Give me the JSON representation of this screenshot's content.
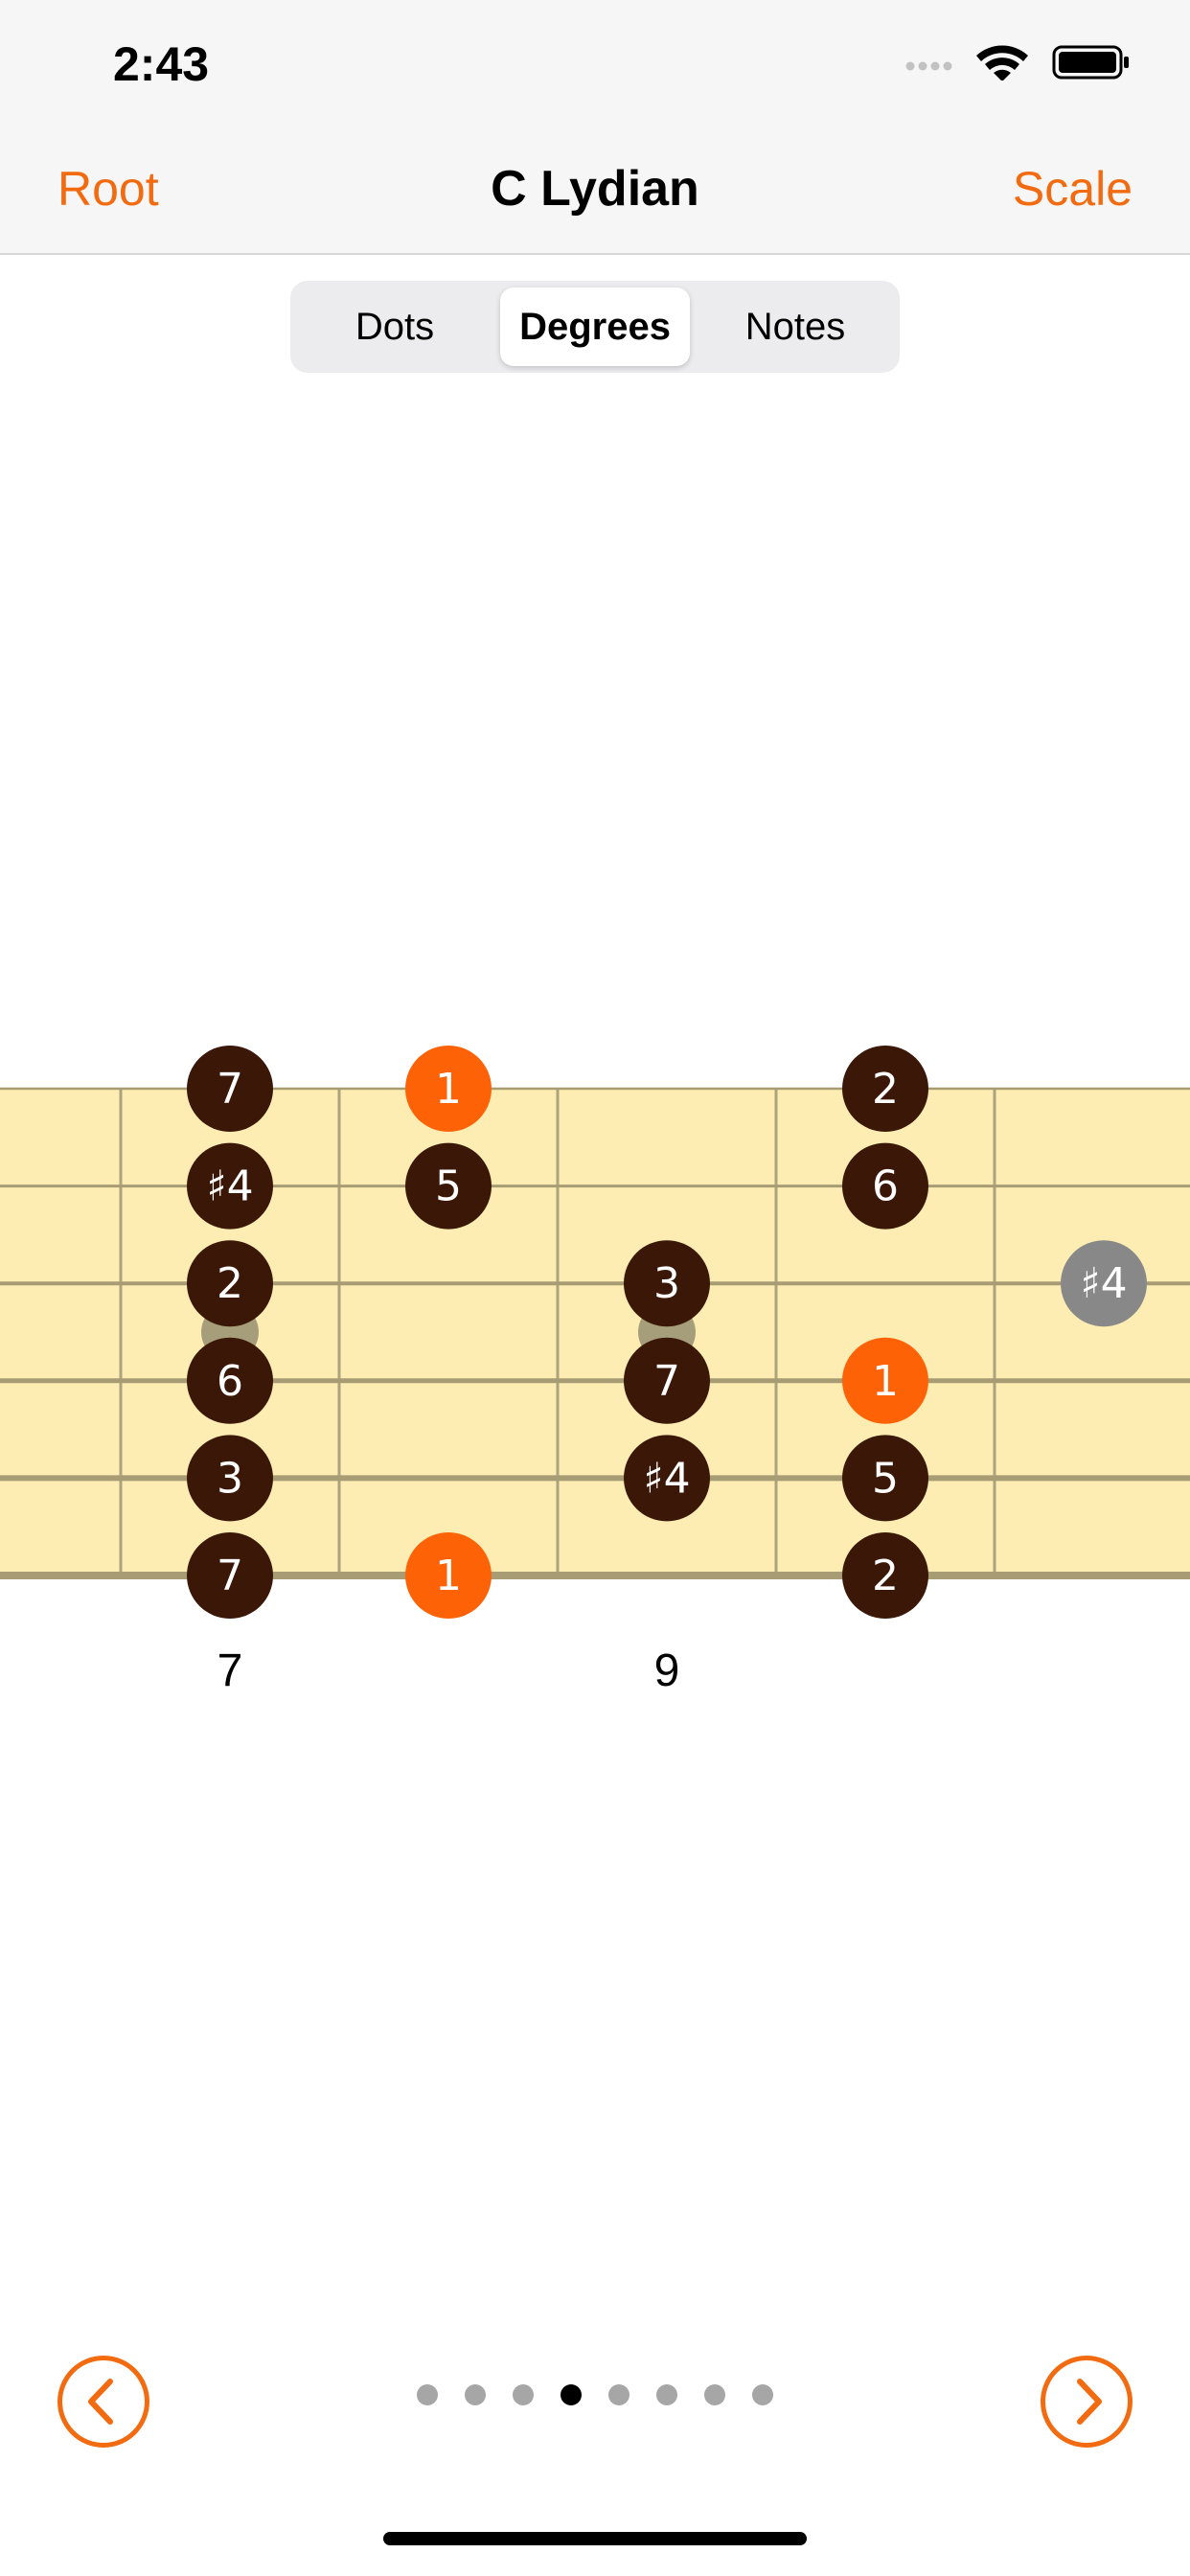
{
  "status": {
    "time": "2:43"
  },
  "nav": {
    "left": "Root",
    "title": "C Lydian",
    "right": "Scale"
  },
  "segments": [
    {
      "label": "Dots",
      "selected": false
    },
    {
      "label": "Degrees",
      "selected": true
    },
    {
      "label": "Notes",
      "selected": false
    }
  ],
  "fretboard": {
    "fret_labels": [
      {
        "fret": 7,
        "label": "7"
      },
      {
        "fret": 9,
        "label": "9"
      }
    ],
    "inlay_frets": [
      7,
      9
    ],
    "notes": [
      {
        "string": 1,
        "fret": 7,
        "label": "7",
        "kind": "degree"
      },
      {
        "string": 1,
        "fret": 8,
        "label": "1",
        "kind": "root"
      },
      {
        "string": 1,
        "fret": 10,
        "label": "2",
        "kind": "degree"
      },
      {
        "string": 2,
        "fret": 7,
        "label": "♯4",
        "kind": "degree"
      },
      {
        "string": 2,
        "fret": 8,
        "label": "5",
        "kind": "degree"
      },
      {
        "string": 2,
        "fret": 10,
        "label": "6",
        "kind": "degree"
      },
      {
        "string": 3,
        "fret": 7,
        "label": "2",
        "kind": "degree"
      },
      {
        "string": 3,
        "fret": 9,
        "label": "3",
        "kind": "degree"
      },
      {
        "string": 3,
        "fret": 11,
        "label": "♯4",
        "kind": "other"
      },
      {
        "string": 4,
        "fret": 7,
        "label": "6",
        "kind": "degree"
      },
      {
        "string": 4,
        "fret": 9,
        "label": "7",
        "kind": "degree"
      },
      {
        "string": 4,
        "fret": 10,
        "label": "1",
        "kind": "root"
      },
      {
        "string": 5,
        "fret": 7,
        "label": "3",
        "kind": "degree"
      },
      {
        "string": 5,
        "fret": 9,
        "label": "♯4",
        "kind": "degree"
      },
      {
        "string": 5,
        "fret": 10,
        "label": "5",
        "kind": "degree"
      },
      {
        "string": 6,
        "fret": 7,
        "label": "7",
        "kind": "degree"
      },
      {
        "string": 6,
        "fret": 8,
        "label": "1",
        "kind": "root"
      },
      {
        "string": 6,
        "fret": 10,
        "label": "2",
        "kind": "degree"
      }
    ]
  },
  "pager": {
    "count": 8,
    "active": 3
  },
  "colors": {
    "accent": "#f26b10",
    "board": "#fdedb3",
    "fret_line": "#aca47e",
    "string": "#a89c74",
    "degree": "#3a1707",
    "root": "#fe6207",
    "other": "#888888",
    "inlay": "#a69e7a"
  },
  "icons": {
    "prev": "chevron-left-icon",
    "next": "chevron-right-icon"
  }
}
